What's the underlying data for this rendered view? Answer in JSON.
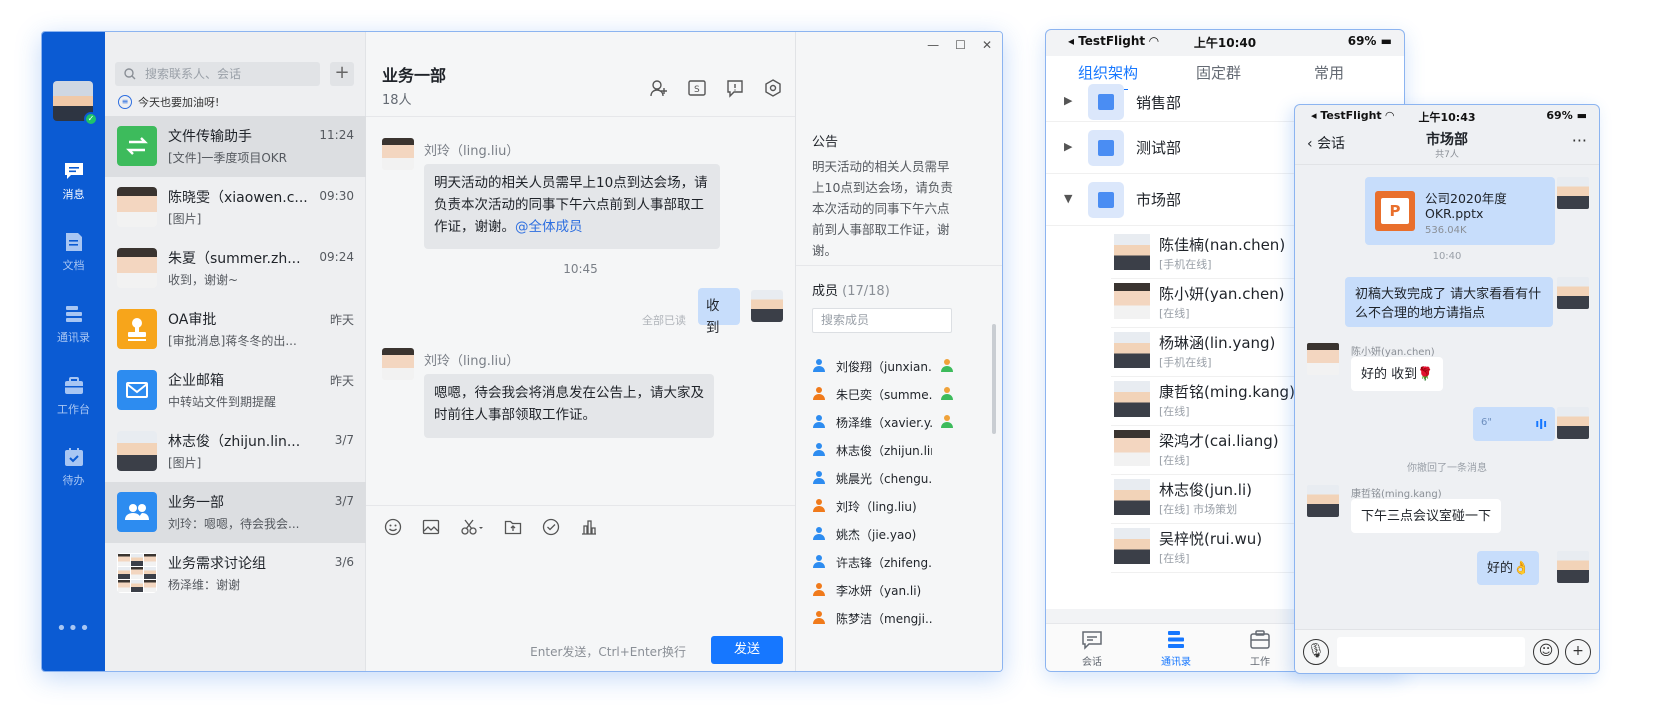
{
  "desktop": {
    "nav": [
      {
        "label": "消息",
        "icon": "chat-icon"
      },
      {
        "label": "文档",
        "icon": "document-icon"
      },
      {
        "label": "通讯录",
        "icon": "contacts-icon"
      },
      {
        "label": "工作台",
        "icon": "briefcase-icon"
      },
      {
        "label": "待办",
        "icon": "calendar-check-icon"
      }
    ],
    "more": "•••",
    "search_placeholder": "搜索联系人、会话",
    "plus": "+",
    "motto": "今天也要加油呀!",
    "conversations": [
      {
        "name": "文件传输助手",
        "time": "11:24",
        "preview": "[文件]一季度项目OKR",
        "color": "#3dbb5c"
      },
      {
        "name": "陈晓雯（xiaowen.c...",
        "time": "09:30",
        "preview": "[图片]"
      },
      {
        "name": "朱夏（summer.zh...",
        "time": "09:24",
        "preview": "收到，谢谢~"
      },
      {
        "name": "OA审批",
        "time": "昨天",
        "preview": "[审批消息]蒋冬冬的出...",
        "color": "#f7a51b"
      },
      {
        "name": "企业邮箱",
        "time": "昨天",
        "preview": "中转站文件到期提醒",
        "color": "#2d8cf0"
      },
      {
        "name": "林志俊（zhijun.lin...",
        "time": "3/7",
        "preview": "[图片]"
      },
      {
        "name": "业务一部",
        "time": "3/7",
        "preview": "刘玲：嗯嗯，待会我会...",
        "color": "#2d8cf0"
      },
      {
        "name": "业务需求讨论组",
        "time": "3/6",
        "preview": "杨泽维：谢谢"
      }
    ],
    "chat": {
      "title": "业务一部",
      "subtitle": "18人",
      "messages": [
        {
          "sender": "刘玲（ling.liu）",
          "text": "明天活动的相关人员需早上10点到达会场，请负责本次活动的同事下午六点前到人事部取工作证，谢谢。",
          "mention": "@全体成员"
        },
        {
          "time": "10:45"
        },
        {
          "read_status": "全部已读",
          "text": "收到"
        },
        {
          "sender": "刘玲（ling.liu）",
          "text": "嗯嗯，待会我会将消息发在公告上，请大家及时前往人事部领取工作证。"
        }
      ],
      "hint": "Enter发送，Ctrl+Enter换行",
      "send": "发送"
    },
    "announcement": {
      "title": "公告",
      "text": "明天活动的相关人员需早上10点到达会场，请负责本次活动的同事下午六点前到人事部取工作证，谢谢。"
    },
    "members": {
      "title": "成员",
      "count": "(17/18)",
      "search_placeholder": "搜索成员",
      "list": [
        {
          "name": "刘俊翔（junxian...",
          "color": "#2d8cf0",
          "role": true
        },
        {
          "name": "朱巳奕（summe...",
          "color": "#f07a1b",
          "role": true
        },
        {
          "name": "杨泽维（xavier.y...",
          "color": "#2d8cf0",
          "role": true
        },
        {
          "name": "林志俊（zhijun.lin)",
          "color": "#2d8cf0"
        },
        {
          "name": "姚晨光（chengu...",
          "color": "#2d8cf0"
        },
        {
          "name": "刘玲（ling.liu)",
          "color": "#f07a1b"
        },
        {
          "name": "姚杰（jie.yao)",
          "color": "#2d8cf0"
        },
        {
          "name": "许志锋（zhifeng...",
          "color": "#2d8cf0"
        },
        {
          "name": "李冰妍（yan.li)",
          "color": "#f07a1b"
        },
        {
          "name": "陈梦洁（mengji...",
          "color": "#f07a1b"
        }
      ]
    }
  },
  "phone1": {
    "status": {
      "carrier": "TestFlight",
      "time": "上午10:40",
      "battery": "69%"
    },
    "tabs": [
      "组织架构",
      "固定群",
      "常用"
    ],
    "departments": [
      "销售部",
      "测试部",
      "市场部"
    ],
    "people": [
      {
        "name": "陈佳楠(nan.chen)",
        "status": "[手机在线]"
      },
      {
        "name": "陈小妍(yan.chen)",
        "status": "[在线]"
      },
      {
        "name": "杨琳涵(lin.yang)",
        "status": "[手机在线]"
      },
      {
        "name": "康哲铭(ming.kang)",
        "status": "[在线]"
      },
      {
        "name": "梁鸿才(cai.liang)",
        "status": "[在线]"
      },
      {
        "name": "林志俊(jun.li)",
        "status": "[在线] 市场策划"
      },
      {
        "name": "吴梓悦(rui.wu)",
        "status": "[在线]"
      }
    ],
    "bottom_tabs": [
      "会话",
      "通讯录",
      "工作"
    ]
  },
  "phone2": {
    "status": {
      "carrier": "TestFlight",
      "time": "上午10:43",
      "battery": "69%"
    },
    "back": "会话",
    "title": "市场部",
    "subtitle": "共7人",
    "more": "···",
    "file": {
      "name": "公司2020年度OKR.pptx",
      "size": "536.04K"
    },
    "time": "10:40",
    "msg1": "初稿大致完成了 请大家看看有什么不合理的地方请指点",
    "sender1": "陈小妍(yan.chen)",
    "reply1": "好的 收到🌹",
    "voice": "6\"",
    "recalled": "你撤回了一条消息",
    "sender2": "康哲铭(ming.kang)",
    "reply2": "下午三点会议室碰一下",
    "msg2": "好的👌"
  }
}
